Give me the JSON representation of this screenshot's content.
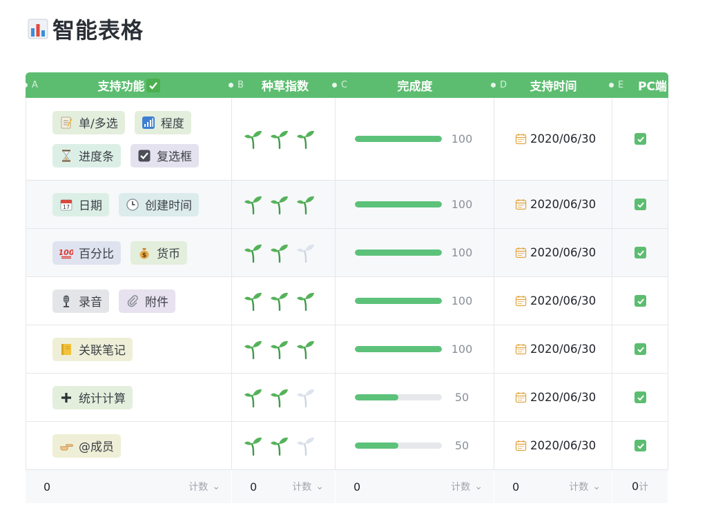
{
  "page": {
    "title": "智能表格",
    "title_icon": "bar-chart-icon"
  },
  "columns": [
    {
      "letter": "A",
      "label": "支持功能",
      "badge_icon": "check-mark-button-icon"
    },
    {
      "letter": "B",
      "label": "种草指数"
    },
    {
      "letter": "C",
      "label": "完成度"
    },
    {
      "letter": "D",
      "label": "支持时间"
    },
    {
      "letter": "E",
      "label": "PC端"
    }
  ],
  "rows": [
    {
      "tags": [
        {
          "icon": "memo-icon",
          "label": "单/多选",
          "color": "#e3eedc"
        },
        {
          "icon": "signal-bars-icon",
          "label": "程度",
          "color": "#e3eedc"
        },
        {
          "icon": "hourglass-icon",
          "label": "进度条",
          "color": "#dcefe6"
        },
        {
          "icon": "ballot-box-check-icon",
          "label": "复选框",
          "color": "#e4e2ef"
        }
      ],
      "rating": 3,
      "rating_max": 3,
      "progress": 100,
      "progress_label": "100",
      "date": "2020/06/30",
      "pc": true
    },
    {
      "tags": [
        {
          "icon": "calendar-icon",
          "label": "日期",
          "color": "#dcefe6"
        },
        {
          "icon": "clock-icon",
          "label": "创建时间",
          "color": "#dcecec"
        }
      ],
      "rating": 3,
      "rating_max": 3,
      "progress": 100,
      "progress_label": "100",
      "date": "2020/06/30",
      "pc": true
    },
    {
      "tags": [
        {
          "icon": "hundred-points-icon",
          "label": "百分比",
          "color": "#dfe3ef"
        },
        {
          "icon": "money-bag-icon",
          "label": "货币",
          "color": "#e3eedc"
        }
      ],
      "rating": 2,
      "rating_max": 3,
      "progress": 100,
      "progress_label": "100",
      "date": "2020/06/30",
      "pc": true
    },
    {
      "tags": [
        {
          "icon": "microphone-icon",
          "label": "录音",
          "color": "#e4e5e8"
        },
        {
          "icon": "paperclip-icon",
          "label": "附件",
          "color": "#e8e1ef"
        }
      ],
      "rating": 3,
      "rating_max": 3,
      "progress": 100,
      "progress_label": "100",
      "date": "2020/06/30",
      "pc": true
    },
    {
      "tags": [
        {
          "icon": "notebook-icon",
          "label": "关联笔记",
          "color": "#eeefd6"
        }
      ],
      "rating": 3,
      "rating_max": 3,
      "progress": 100,
      "progress_label": "100",
      "date": "2020/06/30",
      "pc": true
    },
    {
      "tags": [
        {
          "icon": "plus-icon",
          "label": "统计计算",
          "color": "#e3eedc"
        }
      ],
      "rating": 2,
      "rating_max": 3,
      "progress": 50,
      "progress_label": "50",
      "date": "2020/06/30",
      "pc": true
    },
    {
      "tags": [
        {
          "icon": "pointing-hand-icon",
          "label": "@成员",
          "color": "#eeefd6"
        }
      ],
      "rating": 2,
      "rating_max": 3,
      "progress": 50,
      "progress_label": "50",
      "date": "2020/06/30",
      "pc": true
    }
  ],
  "footer": [
    {
      "value": "0",
      "aggregate": "计数"
    },
    {
      "value": "0",
      "aggregate": "计数"
    },
    {
      "value": "0",
      "aggregate": "计数"
    },
    {
      "value": "0",
      "aggregate": "计数"
    },
    {
      "value": "0",
      "aggregate": "计"
    }
  ],
  "colors": {
    "header": "#5cbd70",
    "progress": "#5cc27a",
    "checkbox": "#5cbd70",
    "sprout_on": "#56b25a",
    "sprout_off": "#dde3ec"
  }
}
